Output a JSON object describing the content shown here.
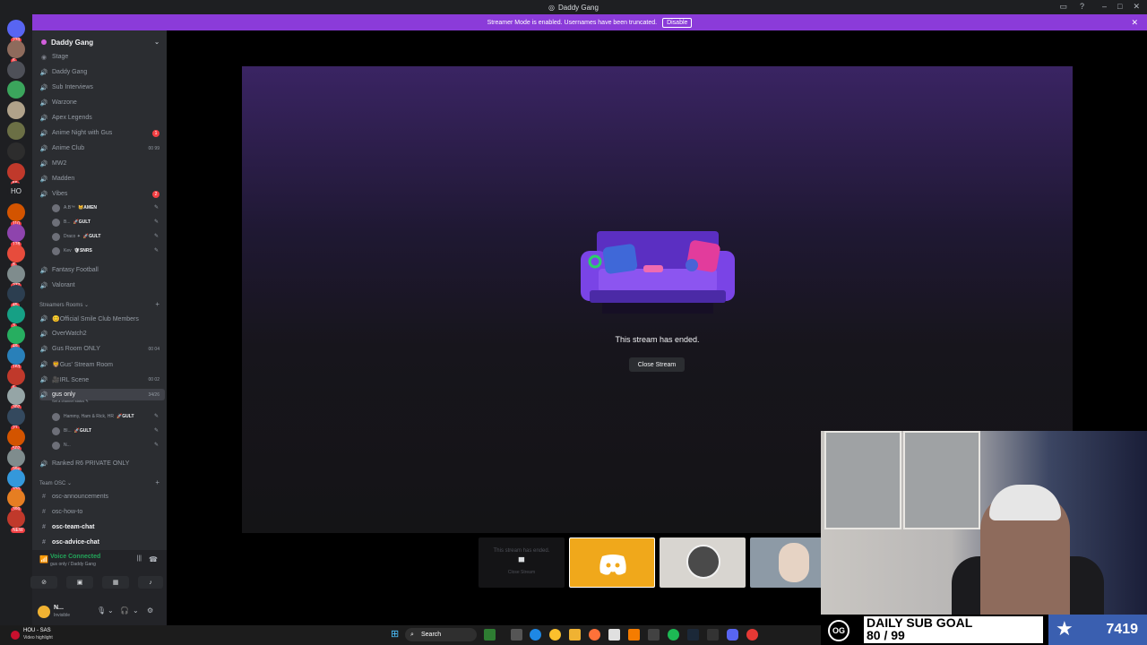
{
  "window": {
    "title": "Daddy Gang",
    "title_icon": "discord-icon"
  },
  "banner": {
    "text": "Streamer Mode is enabled. Usernames have been truncated.",
    "disable_label": "Disable"
  },
  "guilds": [
    {
      "badge": "239"
    },
    {
      "badge": "6"
    },
    {
      "badge": ""
    },
    {
      "badge": ""
    },
    {
      "badge": ""
    },
    {
      "badge": ""
    },
    {
      "badge": ""
    },
    {
      "badge": "56"
    },
    {
      "label": "HO"
    },
    {
      "badge": "110"
    },
    {
      "badge": "128"
    },
    {
      "badge": "8"
    },
    {
      "badge": "277"
    },
    {
      "badge": "45"
    },
    {
      "badge": "3"
    },
    {
      "badge": "49"
    },
    {
      "badge": "163"
    },
    {
      "badge": "6"
    },
    {
      "badge": "307"
    },
    {
      "badge": "21"
    },
    {
      "badge": "502"
    },
    {
      "badge": "99+"
    },
    {
      "badge": "320"
    },
    {
      "badge": "399"
    },
    {
      "badge": "NEW"
    }
  ],
  "sidebar": {
    "server_name": "Daddy Gang",
    "channels_top": [
      {
        "label": "Stage",
        "type": "stage"
      },
      {
        "label": "Daddy Gang",
        "type": "voice"
      },
      {
        "label": "Sub Interviews",
        "type": "voice"
      },
      {
        "label": "Warzone",
        "type": "voice"
      },
      {
        "label": "Apex Legends",
        "type": "voice"
      },
      {
        "label": "Anime Night with Gus",
        "type": "voice",
        "red": "1"
      },
      {
        "label": "Anime Club",
        "type": "voice",
        "count": "00 99"
      },
      {
        "label": "MW2",
        "type": "voice"
      },
      {
        "label": "Madden",
        "type": "voice"
      },
      {
        "label": "Vibes",
        "type": "voice",
        "red": "2"
      }
    ],
    "vibes_users": [
      {
        "name": "A.B™",
        "tag": "😸AMEN"
      },
      {
        "name": "B...",
        "tag": "🚀GULT"
      },
      {
        "name": "Draco ✦",
        "tag": "🚀GULT"
      },
      {
        "name": "Kev",
        "tag": "🛡SNRS"
      }
    ],
    "channels_mid": [
      {
        "label": "Fantasy Football"
      },
      {
        "label": "Valorant"
      }
    ],
    "category_streamers": "Streamers Rooms",
    "channels_streamers": [
      {
        "label": "😊Official Smile Club Members"
      },
      {
        "label": "OverWatch2"
      },
      {
        "label": "Gus Room ONLY",
        "count": "00 04"
      },
      {
        "label": "🦁Gus' Stream Room"
      },
      {
        "label": "🎥IRL Scene",
        "count": "00 02"
      },
      {
        "label": "gus only",
        "count": "34/26",
        "active": true,
        "status": "Set a channel status ✎"
      }
    ],
    "gus_users": [
      {
        "name": "Hammy, Ham & Rick, HR",
        "tag": "🚀GULT"
      },
      {
        "name": "Bl...",
        "tag": "🚀GULT"
      },
      {
        "name": "N...",
        "tag": ""
      }
    ],
    "channel_ranked": "Ranked R6 PRIVATE ONLY",
    "category_team": "Team OSC",
    "text_channels": [
      {
        "label": "osc-announcements",
        "bold": false
      },
      {
        "label": "osc-how-to",
        "bold": false
      },
      {
        "label": "osc-team-chat",
        "bold": true
      },
      {
        "label": "osc-advice-chat",
        "bold": true
      }
    ]
  },
  "voice": {
    "title": "Voice Connected",
    "subtitle": "gus only / Daddy Gang"
  },
  "user": {
    "name": "N...",
    "status": "Invisible"
  },
  "stream": {
    "ended_text": "This stream has ended.",
    "close_label": "Close Stream"
  },
  "tiles": {
    "t0_text": "This stream has ended.",
    "t0_close": "Close Stream"
  },
  "subgoal": {
    "line1": "DAILY SUB GOAL",
    "line2": "80 / 99",
    "count": "7419",
    "logo": "OG"
  },
  "taskbar": {
    "weather": "HOU - SAS",
    "weather_sub": "Video highlight",
    "search": "Search"
  },
  "colors": {
    "banner": "#8b3bd9",
    "voice_green": "#23a55a",
    "tile_discord": "#f0a81b",
    "sub_box": "#3a5fb0"
  }
}
